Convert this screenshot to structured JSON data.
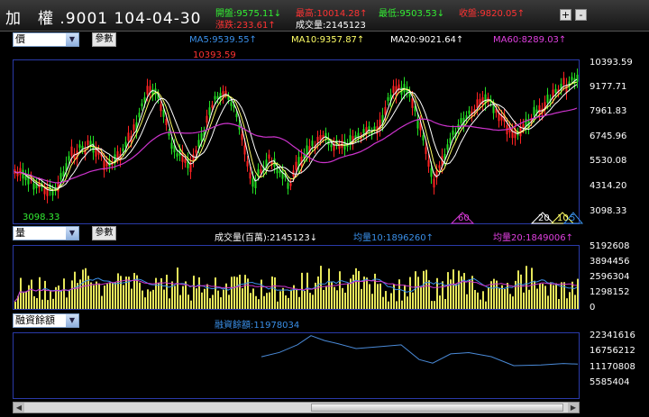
{
  "header": {
    "title": "加　權 .9001 104-04-30",
    "open": "開盤:9575.11↓",
    "high": "最高:10014.28↑",
    "low": "最低:9503.53↓",
    "close": "收盤:9820.05↑",
    "change": "漲跌:233.61↑",
    "volume": "成交量:2145123",
    "btn_plus": "+",
    "btn_minus": "-"
  },
  "price_panel": {
    "select": "價",
    "params_button": "參數",
    "ma5": "MA5:9539.55↑",
    "ma10": "MA10:9357.87↑",
    "ma20": "MA20:9021.64↑",
    "ma60": "MA60:8289.03↑",
    "high_mark": "10393.59",
    "low_mark": "3098.33",
    "axis": [
      "10393.59",
      "9177.71",
      "7961.83",
      "6745.96",
      "5530.08",
      "4314.20",
      "3098.33"
    ],
    "flags": [
      "60",
      "20",
      "10",
      "5"
    ]
  },
  "volume_panel": {
    "select": "量",
    "params_button": "參數",
    "vol": "成交量(百萬):2145123↓",
    "avg10": "均量10:1896260↑",
    "avg20": "均量20:1849006↑",
    "axis": [
      "5192608",
      "3894456",
      "2596304",
      "1298152",
      "0"
    ]
  },
  "margin_panel": {
    "select": "融資餘額",
    "value": "融資餘額:11978034",
    "axis": [
      "22341616",
      "16756212",
      "11170808",
      "5585404"
    ]
  },
  "colors": {
    "ma5": "#ffffff",
    "ma10": "#ffff66",
    "ma20": "#ffffff",
    "ma60": "#cc33cc",
    "up": "#ff2222",
    "down": "#22dd22",
    "volume": "#e6e65a",
    "margin": "#4a8ad8",
    "border": "#2a3aa8",
    "label_blue": "#3a8fe8",
    "label_magenta": "#e040e0"
  }
}
